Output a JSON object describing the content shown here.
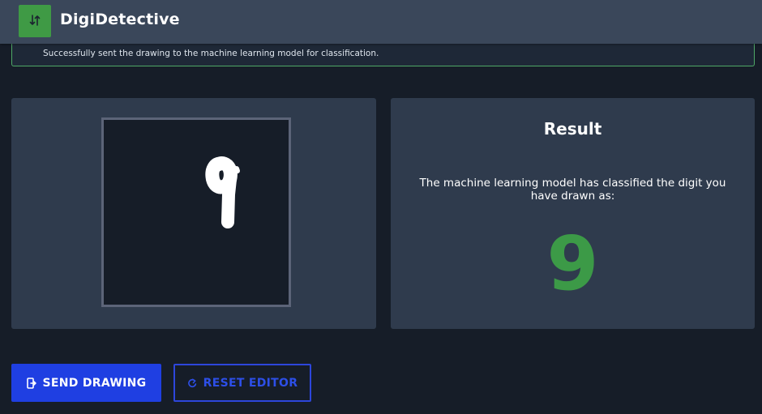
{
  "app": {
    "title": "DigiDetective",
    "logo_icon": "sort-arrows-icon",
    "brand_color": "#3f9a45"
  },
  "alert": {
    "message": "Successfully sent the drawing to the machine learning model for classification.",
    "border_color": "#4fa866"
  },
  "editor": {
    "drawn_stroke_color": "#ffffff"
  },
  "result": {
    "title": "Result",
    "description": "The machine learning model has classified the digit you have drawn as:",
    "predicted_digit": "9",
    "digit_color": "#3c9a47"
  },
  "actions": {
    "send_label": "SEND DRAWING",
    "send_icon": "send-icon",
    "reset_label": "RESET EDITOR",
    "reset_icon": "reset-icon",
    "accent_color": "#1f3fe2"
  }
}
